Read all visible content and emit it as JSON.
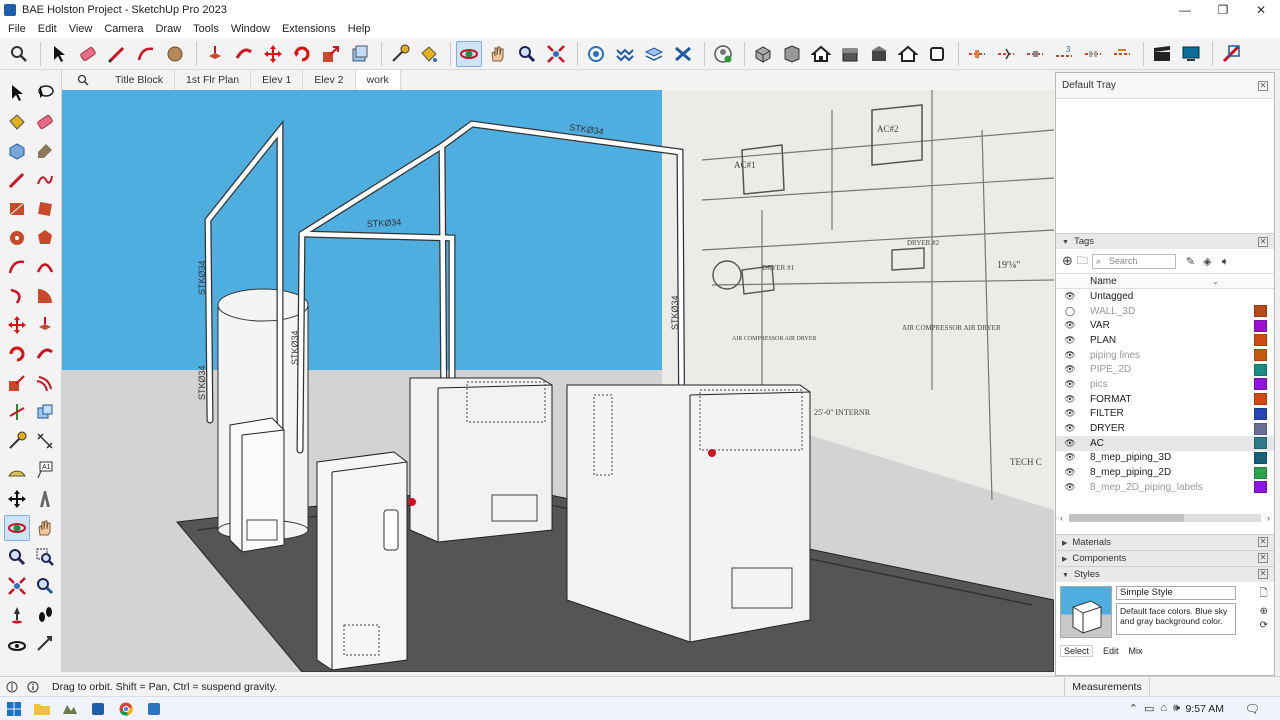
{
  "window": {
    "title": "BAE Holston Project - SketchUp Pro 2023"
  },
  "menu": [
    "File",
    "Edit",
    "View",
    "Camera",
    "Draw",
    "Tools",
    "Window",
    "Extensions",
    "Help"
  ],
  "scene_tabs": [
    "Title Block",
    "1st Flr Plan",
    "Elev 1",
    "Elev 2",
    "work"
  ],
  "viewport": {
    "pipe_labels": [
      "STKØ34",
      "STKØ34",
      "STKØ34",
      "STKØ34",
      "STKØ34",
      "STKØ34"
    ],
    "drawing_notes": [
      "AC#1",
      "AC#2",
      "DRYER #1",
      "DRYER #2",
      "AIR COMPRESSOR\nAIR DRYER",
      "AIR COMPRESSOR\nAIR DRYER",
      "19'¼\"",
      "25'-0\"\nINTERNR",
      "TECH C"
    ]
  },
  "tray": {
    "title": "Default Tray",
    "tags": {
      "header": "Tags",
      "search_placeholder": "Search",
      "col_name": "Name",
      "rows": [
        {
          "name": "Untagged",
          "visible": true,
          "color": ""
        },
        {
          "name": "WALL_3D",
          "visible": false,
          "color": "#b94a1a"
        },
        {
          "name": "VAR",
          "visible": true,
          "color": "#9b12d6"
        },
        {
          "name": "PLAN",
          "visible": true,
          "color": "#cf4c12"
        },
        {
          "name": "piping lines",
          "visible": true,
          "color": "#c9590f"
        },
        {
          "name": "PIPE_2D",
          "visible": true,
          "color": "#1a8a84"
        },
        {
          "name": "pics",
          "visible": true,
          "color": "#8d16d8"
        },
        {
          "name": "FORMAT",
          "visible": true,
          "color": "#cf4a10"
        },
        {
          "name": "FILTER",
          "visible": true,
          "color": "#2346b7"
        },
        {
          "name": "DRYER",
          "visible": true,
          "color": "#6b6e98"
        },
        {
          "name": "AC",
          "visible": true,
          "color": "#2a7a8a"
        },
        {
          "name": "8_mep_piping_3D",
          "visible": true,
          "color": "#17627a"
        },
        {
          "name": "8_mep_piping_2D",
          "visible": true,
          "color": "#2ca34a"
        },
        {
          "name": "8_mep_2D_piping_labels",
          "visible": true,
          "color": "#8c16de"
        }
      ]
    },
    "materials": "Materials",
    "components": "Components",
    "styles": {
      "header": "Styles",
      "style_name": "Simple Style",
      "style_desc": "Default face colors. Blue sky and gray background color.",
      "tabs": [
        "Select",
        "Edit",
        "Mix"
      ]
    }
  },
  "status": {
    "message": "Drag to orbit. Shift = Pan, Ctrl = suspend gravity.",
    "measurements_label": "Measurements"
  },
  "taskbar": {
    "clock": "9:57 AM"
  }
}
